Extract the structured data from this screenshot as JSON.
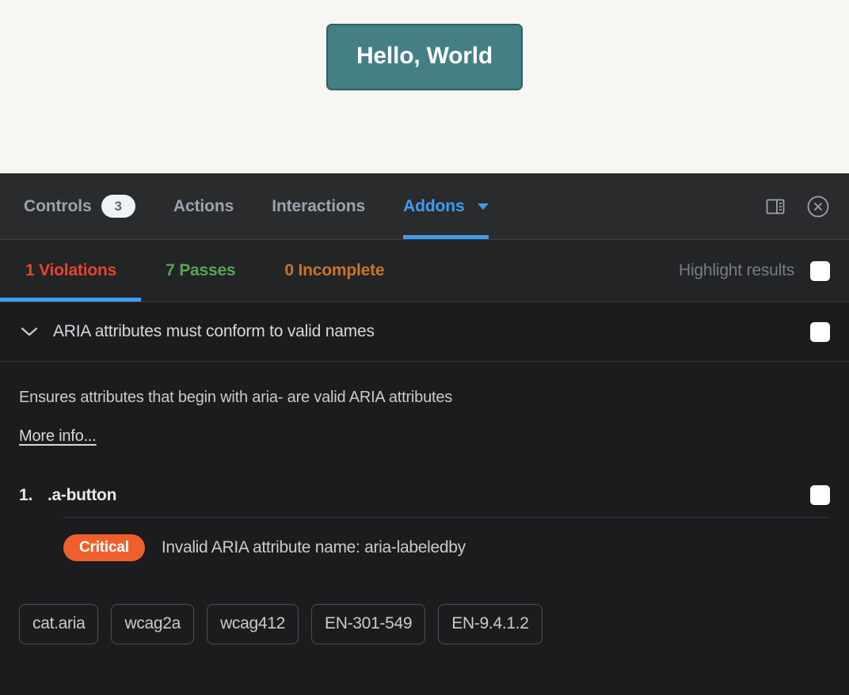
{
  "preview": {
    "button_label": "Hello, World",
    "background_color": "#f7f6f3",
    "button_bg": "#447f86",
    "button_border": "#2f6067"
  },
  "panel": {
    "toolbar": {
      "tabs": [
        {
          "label": "Controls",
          "badge": "3",
          "active": false
        },
        {
          "label": "Actions",
          "badge": null,
          "active": false
        },
        {
          "label": "Interactions",
          "badge": null,
          "active": false
        },
        {
          "label": "Addons",
          "badge": null,
          "active": true,
          "has_caret": true
        }
      ],
      "icons": [
        {
          "name": "panel-layout-icon"
        },
        {
          "name": "close-circle-icon"
        }
      ],
      "accent_color": "#3f9cf0"
    },
    "results": {
      "tabs": [
        {
          "label": "1 Violations",
          "color": "#e5452a",
          "active": true
        },
        {
          "label": "7 Passes",
          "color": "#5aa356",
          "active": false
        },
        {
          "label": "0 Incomplete",
          "color": "#c9742a",
          "active": false
        }
      ],
      "highlight_label": "Highlight results",
      "highlight_checked": false
    },
    "violation": {
      "title": "ARIA attributes must conform to valid names",
      "expanded": true,
      "checked": false,
      "description": "Ensures attributes that begin with aria- are valid ARIA attributes",
      "more_info_label": "More info...",
      "nodes": [
        {
          "index": "1.",
          "target": ".a-button",
          "severity": "Critical",
          "severity_color": "#ef5f2d",
          "message": "Invalid ARIA attribute name: aria-labeledby",
          "checked": false
        }
      ],
      "tags": [
        "cat.aria",
        "wcag2a",
        "wcag412",
        "EN-301-549",
        "EN-9.4.1.2"
      ]
    }
  }
}
